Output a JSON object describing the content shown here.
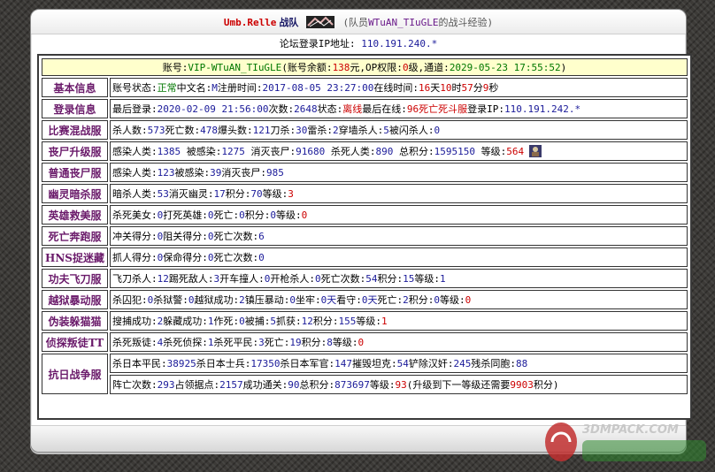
{
  "header": {
    "team_name": "Umb.Relle",
    "team_suffix": "战队",
    "subtitle_prefix": "(队员",
    "member": "WTuAN_TIuGLE",
    "subtitle_suffix": "的战斗经验)",
    "ip_label": "论坛登录IP地址:",
    "ip_value": "110.191.240.*"
  },
  "account": {
    "label": "账号:",
    "id": "VIP-WTuAN_TIuGLE",
    "balance_label": "(账号余额:",
    "balance": "138",
    "balance_unit": "元,OP权限:",
    "op_level": "0",
    "op_unit": "级,通道:",
    "channel_date": "2029-05-23 17:55:52",
    "close": ")"
  },
  "rows": {
    "basic": {
      "label": "基本信息",
      "parts": [
        {
          "t": "账号状态:",
          "c": "k"
        },
        {
          "t": "正常",
          "c": "green"
        },
        {
          "t": " 中文名:",
          "c": "k"
        },
        {
          "t": "M",
          "c": "v"
        },
        {
          "t": " 注册时间:",
          "c": "k"
        },
        {
          "t": "2017-08-05 23:27:00",
          "c": "v"
        },
        {
          "t": " 在线时间:",
          "c": "k"
        },
        {
          "t": "16",
          "c": "vr"
        },
        {
          "t": "天",
          "c": "k"
        },
        {
          "t": "10",
          "c": "vr"
        },
        {
          "t": "时",
          "c": "k"
        },
        {
          "t": "57",
          "c": "vr"
        },
        {
          "t": "分",
          "c": "k"
        },
        {
          "t": "9",
          "c": "vr"
        },
        {
          "t": "秒",
          "c": "k"
        }
      ]
    },
    "login": {
      "label": "登录信息",
      "parts": [
        {
          "t": "最后登录:",
          "c": "k"
        },
        {
          "t": "2020-02-09 21:56:00",
          "c": "v"
        },
        {
          "t": " 次数:",
          "c": "k"
        },
        {
          "t": "2648",
          "c": "v"
        },
        {
          "t": " 状态:",
          "c": "k"
        },
        {
          "t": "离线",
          "c": "vr"
        },
        {
          "t": " 最后在线:",
          "c": "k"
        },
        {
          "t": "96死亡死斗服",
          "c": "vr"
        },
        {
          "t": " 登录IP:",
          "c": "k"
        },
        {
          "t": "110.191.242.*",
          "c": "v"
        }
      ]
    },
    "mixed": {
      "label": "比赛混战服",
      "parts": [
        {
          "t": "杀人数:",
          "c": "k"
        },
        {
          "t": "573",
          "c": "v"
        },
        {
          "t": " 死亡数:",
          "c": "k"
        },
        {
          "t": "478",
          "c": "v"
        },
        {
          "t": " 爆头数:",
          "c": "k"
        },
        {
          "t": "121",
          "c": "v"
        },
        {
          "t": " 刀杀:",
          "c": "k"
        },
        {
          "t": "30",
          "c": "v"
        },
        {
          "t": " 雷杀:",
          "c": "k"
        },
        {
          "t": "2",
          "c": "v"
        },
        {
          "t": " 穿墙杀人:",
          "c": "k"
        },
        {
          "t": "5",
          "c": "v"
        },
        {
          "t": " 被闪杀人:",
          "c": "k"
        },
        {
          "t": "0",
          "c": "v"
        }
      ]
    },
    "zombie_up": {
      "label": "丧尸升级服",
      "parts": [
        {
          "t": "感染人类:",
          "c": "k"
        },
        {
          "t": "1385",
          "c": "v"
        },
        {
          "t": " 被感染:",
          "c": "k"
        },
        {
          "t": "1275",
          "c": "v"
        },
        {
          "t": " 消灭丧尸:",
          "c": "k"
        },
        {
          "t": "91680",
          "c": "v"
        },
        {
          "t": " 杀死人类:",
          "c": "k"
        },
        {
          "t": "890",
          "c": "v"
        },
        {
          "t": " 总积分:",
          "c": "k"
        },
        {
          "t": "1595150",
          "c": "v"
        },
        {
          "t": " 等级:",
          "c": "k"
        },
        {
          "t": "564",
          "c": "vr"
        }
      ]
    },
    "zombie": {
      "label": "普通丧尸服",
      "parts": [
        {
          "t": "感染人类:",
          "c": "k"
        },
        {
          "t": "123",
          "c": "v"
        },
        {
          "t": " 被感染:",
          "c": "k"
        },
        {
          "t": "39",
          "c": "v"
        },
        {
          "t": " 消灭丧尸:",
          "c": "k"
        },
        {
          "t": "985",
          "c": "v"
        }
      ]
    },
    "ghost": {
      "label": "幽灵暗杀服",
      "parts": [
        {
          "t": "暗杀人类:",
          "c": "k"
        },
        {
          "t": "53",
          "c": "v"
        },
        {
          "t": " 消灭幽灵:",
          "c": "k"
        },
        {
          "t": "17",
          "c": "v"
        },
        {
          "t": " 积分:",
          "c": "k"
        },
        {
          "t": "70",
          "c": "v"
        },
        {
          "t": " 等级:",
          "c": "k"
        },
        {
          "t": "3",
          "c": "vr"
        }
      ]
    },
    "hero": {
      "label": "英雄救美服",
      "parts": [
        {
          "t": "杀死美女:",
          "c": "k"
        },
        {
          "t": "0",
          "c": "v"
        },
        {
          "t": " 打死英雄:",
          "c": "k"
        },
        {
          "t": "0",
          "c": "v"
        },
        {
          "t": " 死亡:",
          "c": "k"
        },
        {
          "t": "0",
          "c": "v"
        },
        {
          "t": " 积分:",
          "c": "k"
        },
        {
          "t": "0",
          "c": "v"
        },
        {
          "t": " 等级:",
          "c": "k"
        },
        {
          "t": "0",
          "c": "vr"
        }
      ]
    },
    "death_run": {
      "label": "死亡奔跑服",
      "parts": [
        {
          "t": "冲关得分:",
          "c": "k"
        },
        {
          "t": "0",
          "c": "v"
        },
        {
          "t": " 阻关得分:",
          "c": "k"
        },
        {
          "t": "0",
          "c": "v"
        },
        {
          "t": " 死亡次数:",
          "c": "k"
        },
        {
          "t": "6",
          "c": "v"
        }
      ]
    },
    "hns": {
      "label": "HNS捉迷藏",
      "parts": [
        {
          "t": "抓人得分:",
          "c": "k"
        },
        {
          "t": "0",
          "c": "v"
        },
        {
          "t": " 保命得分:",
          "c": "k"
        },
        {
          "t": "0",
          "c": "v"
        },
        {
          "t": " 死亡次数:",
          "c": "k"
        },
        {
          "t": "0",
          "c": "v"
        }
      ]
    },
    "kungfu": {
      "label": "功夫飞刀服",
      "parts": [
        {
          "t": "飞刀杀人:",
          "c": "k"
        },
        {
          "t": "12",
          "c": "v"
        },
        {
          "t": " 踢死敌人:",
          "c": "k"
        },
        {
          "t": "3",
          "c": "v"
        },
        {
          "t": " 开车撞人:",
          "c": "k"
        },
        {
          "t": "0",
          "c": "v"
        },
        {
          "t": " 开枪杀人:",
          "c": "k"
        },
        {
          "t": "0",
          "c": "v"
        },
        {
          "t": " 死亡次数:",
          "c": "k"
        },
        {
          "t": "54",
          "c": "v"
        },
        {
          "t": " 积分:",
          "c": "k"
        },
        {
          "t": "15",
          "c": "v"
        },
        {
          "t": " 等级:",
          "c": "k"
        },
        {
          "t": "1",
          "c": "v"
        }
      ]
    },
    "jailbreak": {
      "label": "越狱暴动服",
      "parts": [
        {
          "t": "杀囚犯:",
          "c": "k"
        },
        {
          "t": "0",
          "c": "v"
        },
        {
          "t": " 杀狱警:",
          "c": "k"
        },
        {
          "t": "0",
          "c": "v"
        },
        {
          "t": " 越狱成功:",
          "c": "k"
        },
        {
          "t": "2",
          "c": "v"
        },
        {
          "t": " 镇压暴动:",
          "c": "k"
        },
        {
          "t": "0",
          "c": "v"
        },
        {
          "t": " 坐牢:",
          "c": "k"
        },
        {
          "t": "0天",
          "c": "v"
        },
        {
          "t": " 看守:",
          "c": "k"
        },
        {
          "t": "0天",
          "c": "v"
        },
        {
          "t": " 死亡:",
          "c": "k"
        },
        {
          "t": "2",
          "c": "v"
        },
        {
          "t": " 积分:",
          "c": "k"
        },
        {
          "t": "0",
          "c": "v"
        },
        {
          "t": " 等级:",
          "c": "k"
        },
        {
          "t": "0",
          "c": "vr"
        }
      ]
    },
    "disguise": {
      "label": "伪装躲猫猫",
      "parts": [
        {
          "t": "搜捕成功:",
          "c": "k"
        },
        {
          "t": "2",
          "c": "v"
        },
        {
          "t": " 躲藏成功:",
          "c": "k"
        },
        {
          "t": "1",
          "c": "v"
        },
        {
          "t": " 作死:",
          "c": "k"
        },
        {
          "t": "0",
          "c": "v"
        },
        {
          "t": " 被捕:",
          "c": "k"
        },
        {
          "t": "5",
          "c": "v"
        },
        {
          "t": " 抓获:",
          "c": "k"
        },
        {
          "t": "12",
          "c": "v"
        },
        {
          "t": " 积分:",
          "c": "k"
        },
        {
          "t": "155",
          "c": "v"
        },
        {
          "t": " 等级:",
          "c": "k"
        },
        {
          "t": "1",
          "c": "vr"
        }
      ]
    },
    "detective": {
      "label": "侦探叛徒TT",
      "parts": [
        {
          "t": "杀死叛徒:",
          "c": "k"
        },
        {
          "t": "4",
          "c": "v"
        },
        {
          "t": " 杀死侦探:",
          "c": "k"
        },
        {
          "t": "1",
          "c": "v"
        },
        {
          "t": " 杀死平民:",
          "c": "k"
        },
        {
          "t": "3",
          "c": "v"
        },
        {
          "t": " 死亡:",
          "c": "k"
        },
        {
          "t": "19",
          "c": "v"
        },
        {
          "t": " 积分:",
          "c": "k"
        },
        {
          "t": "8",
          "c": "v"
        },
        {
          "t": " 等级:",
          "c": "k"
        },
        {
          "t": "0",
          "c": "vr"
        }
      ]
    },
    "war": {
      "label": "抗日战争服",
      "line1": [
        {
          "t": "杀日本平民:",
          "c": "k"
        },
        {
          "t": "38925",
          "c": "v"
        },
        {
          "t": " 杀日本士兵:",
          "c": "k"
        },
        {
          "t": "17350",
          "c": "v"
        },
        {
          "t": " 杀日本军官:",
          "c": "k"
        },
        {
          "t": "147",
          "c": "v"
        },
        {
          "t": " 摧毁坦克:",
          "c": "k"
        },
        {
          "t": "54",
          "c": "v"
        },
        {
          "t": " 铲除汉奸:",
          "c": "k"
        },
        {
          "t": "245",
          "c": "v"
        },
        {
          "t": " 残杀同胞:",
          "c": "k"
        },
        {
          "t": "88",
          "c": "v"
        }
      ],
      "line2": [
        {
          "t": "阵亡次数:",
          "c": "k"
        },
        {
          "t": "293",
          "c": "v"
        },
        {
          "t": " 占领据点:",
          "c": "k"
        },
        {
          "t": "2157",
          "c": "v"
        },
        {
          "t": " 成功通关:",
          "c": "k"
        },
        {
          "t": "90",
          "c": "v"
        },
        {
          "t": " 总积分:",
          "c": "k"
        },
        {
          "t": "873697",
          "c": "v"
        },
        {
          "t": " 等级:",
          "c": "k"
        },
        {
          "t": "93",
          "c": "vr"
        },
        {
          "t": " (升级到下一等级还需要",
          "c": "k"
        },
        {
          "t": "9903",
          "c": "vr"
        },
        {
          "t": "积分)",
          "c": "k"
        }
      ]
    }
  },
  "icons": {
    "team_logo": "team-logo-icon",
    "rank": "rank-badge-icon",
    "watermark": "site-watermark-logo"
  },
  "watermark_text": "3DMPACK.COM",
  "colors": {
    "label": "#6a1a6a",
    "value": "#1a1a99",
    "highlight": "#cc0000",
    "status_ok": "#007700",
    "account_bg": "#ffffcc"
  }
}
